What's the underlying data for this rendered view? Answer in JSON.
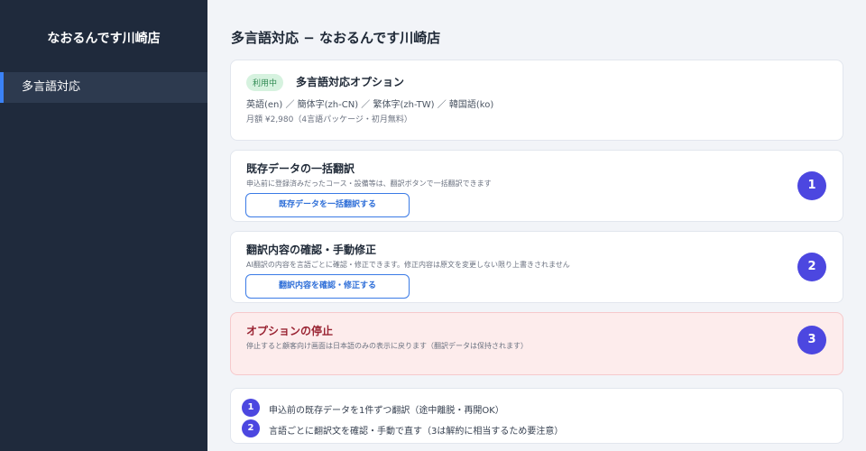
{
  "sidebar": {
    "store_name": "なおるんです川崎店",
    "items": [
      {
        "label": "多言語対応",
        "active": true
      }
    ]
  },
  "header": {
    "title": "多言語対応 − なおるんです川崎店"
  },
  "option": {
    "badge": "利用中",
    "title": "多言語対応オプション",
    "languages": "英語(en) ／ 簡体字(zh-CN) ／ 繁体字(zh-TW) ／ 韓国語(ko)",
    "price": "月額 ¥2,980（4言語パッケージ・初月無料）"
  },
  "steps": [
    {
      "number": "1",
      "title": "既存データの一括翻訳",
      "description": "申込前に登録済みだったコース・設備等は、翻訳ボタンで一括翻訳できます",
      "button": "既存データを一括翻訳する"
    },
    {
      "number": "2",
      "title": "翻訳内容の確認・手動修正",
      "description": "AI翻訳の内容を言語ごとに確認・修正できます。修正内容は原文を変更しない限り上書きされません",
      "button": "翻訳内容を確認・修正する"
    },
    {
      "number": "3",
      "title": "オプションの停止",
      "description": "停止すると顧客向け画面は日本語のみの表示に戻ります（翻訳データは保持されます）"
    }
  ],
  "notes": [
    {
      "number": "1",
      "text": "申込前の既存データを1件ずつ翻訳（途中離脱・再開OK）"
    },
    {
      "number": "2",
      "text": "言語ごとに翻訳文を確認・手動で直す（3は解約に相当するため要注意）"
    }
  ],
  "colors": {
    "sidebar_bg": "#1f2a3c",
    "accent": "#3b82f6",
    "step_circle": "#4c47e0",
    "danger_bg": "#fdecec",
    "badge_bg": "#d6f2df"
  }
}
